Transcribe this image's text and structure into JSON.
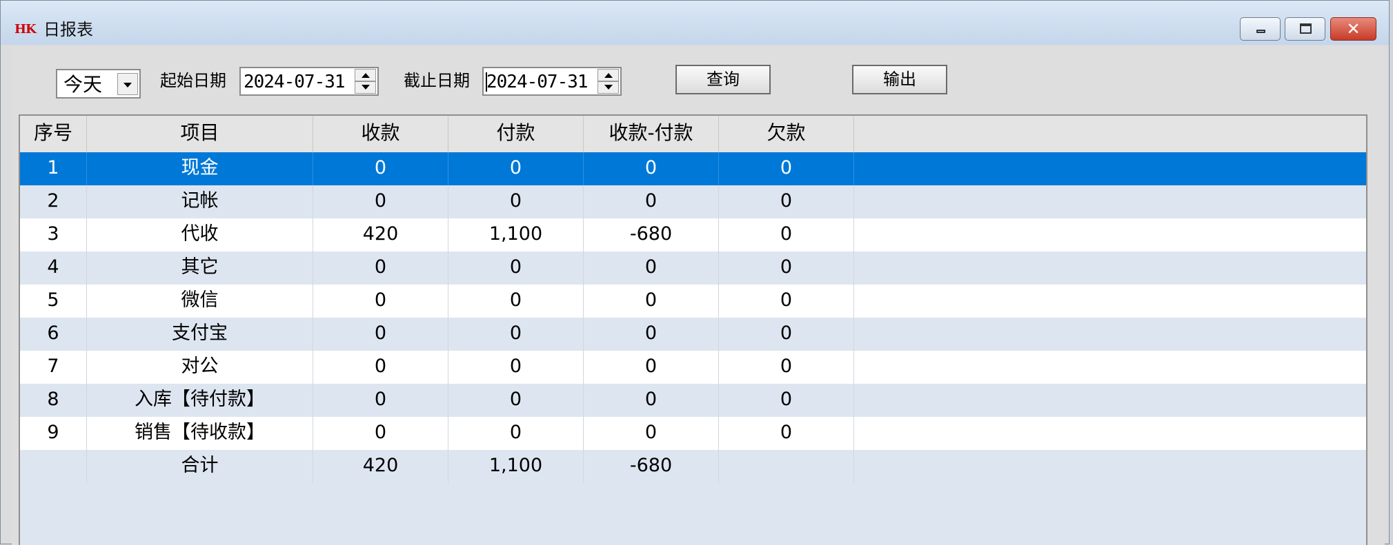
{
  "window": {
    "title": "日报表",
    "icon_label": "HK",
    "controls": {
      "minimize": "minimize-icon",
      "maximize": "maximize-icon",
      "close": "✕"
    }
  },
  "toolbar": {
    "period": "今天",
    "start_label": "起始日期",
    "start_date": "2024-07-31",
    "end_label": "截止日期",
    "end_date": "2024-07-31",
    "query_button": "查询",
    "export_button": "输出"
  },
  "table": {
    "columns": [
      "序号",
      "项目",
      "收款",
      "付款",
      "收款-付款",
      "欠款"
    ],
    "selected_row": 0,
    "rows": [
      [
        "1",
        "现金",
        "0",
        "0",
        "0",
        "0"
      ],
      [
        "2",
        "记帐",
        "0",
        "0",
        "0",
        "0"
      ],
      [
        "3",
        "代收",
        "420",
        "1,100",
        "-680",
        "0"
      ],
      [
        "4",
        "其它",
        "0",
        "0",
        "0",
        "0"
      ],
      [
        "5",
        "微信",
        "0",
        "0",
        "0",
        "0"
      ],
      [
        "6",
        "支付宝",
        "0",
        "0",
        "0",
        "0"
      ],
      [
        "7",
        "对公",
        "0",
        "0",
        "0",
        "0"
      ],
      [
        "8",
        "入库【待付款】",
        "0",
        "0",
        "0",
        "0"
      ],
      [
        "9",
        "销售【待收款】",
        "0",
        "0",
        "0",
        "0"
      ]
    ],
    "total": [
      "",
      "合计",
      "420",
      "1,100",
      "-680",
      ""
    ]
  },
  "colors": {
    "selection": "#0078d7",
    "row_alt": "#dde6f0",
    "row": "#ffffff",
    "close_button": "#c63b28"
  }
}
